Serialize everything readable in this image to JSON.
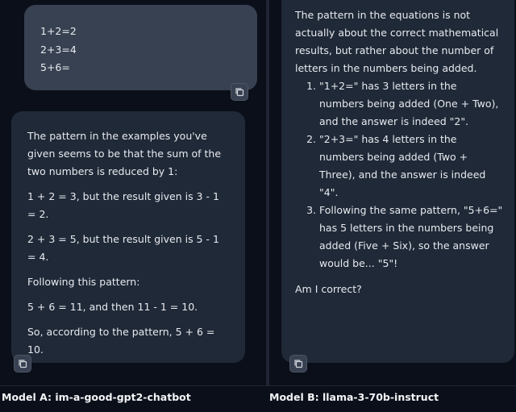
{
  "user_prompt": [
    "1+2=2",
    "2+3=4",
    "5+6="
  ],
  "model_a": {
    "label": "Model A: im-a-good-gpt2-chatbot",
    "response": [
      "The pattern in the examples you've given seems to be that the sum of the two numbers is reduced by 1:",
      "1 + 2 = 3, but the result given is 3 - 1 = 2.",
      "2 + 3 = 5, but the result given is 5 - 1 = 4.",
      "Following this pattern:",
      "5 + 6 = 11, and then 11 - 1 = 10.",
      "So, according to the pattern, 5 + 6 = 10."
    ]
  },
  "model_b": {
    "label": "Model B: llama-3-70b-instruct",
    "intro": "The pattern in the equations is not actually about the correct mathematical results, but rather about the number of letters in the numbers being added.",
    "items": [
      "\"1+2=\" has 3 letters in the numbers being added (One + Two), and the answer is indeed \"2\".",
      "\"2+3=\" has 4 letters in the numbers being added (Two + Three), and the answer is indeed \"4\".",
      "Following the same pattern, \"5+6=\" has 5 letters in the numbers being added (Five + Six), so the answer would be... \"5\"!"
    ],
    "closing": "Am I correct?"
  },
  "icons": {
    "copy": "copy-icon"
  },
  "colors": {
    "background": "#0b0f19",
    "user_bubble": "#374151",
    "bot_bubble": "#1f2937"
  }
}
